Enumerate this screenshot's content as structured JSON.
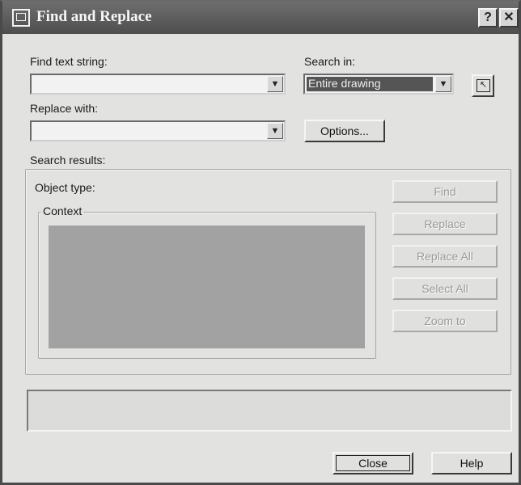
{
  "window": {
    "title": "Find and Replace",
    "help_btn": "?",
    "close_btn": "✕"
  },
  "find": {
    "label": "Find text string:",
    "value": ""
  },
  "replace": {
    "label": "Replace with:",
    "value": ""
  },
  "search_in": {
    "label": "Search in:",
    "value": "Entire drawing"
  },
  "options_button": "Options...",
  "pick_icon": "↖",
  "results": {
    "label": "Search results:",
    "object_type_label": "Object type:",
    "context_legend": "Context"
  },
  "actions": {
    "find": "Find",
    "replace": "Replace",
    "replace_all": "Replace All",
    "select_all": "Select All",
    "zoom_to": "Zoom to"
  },
  "footer": {
    "close": "Close",
    "help": "Help"
  },
  "colors": {
    "titlebar": "#5a5a5a",
    "selection": "#555555",
    "context_area": "#a2a2a2"
  }
}
